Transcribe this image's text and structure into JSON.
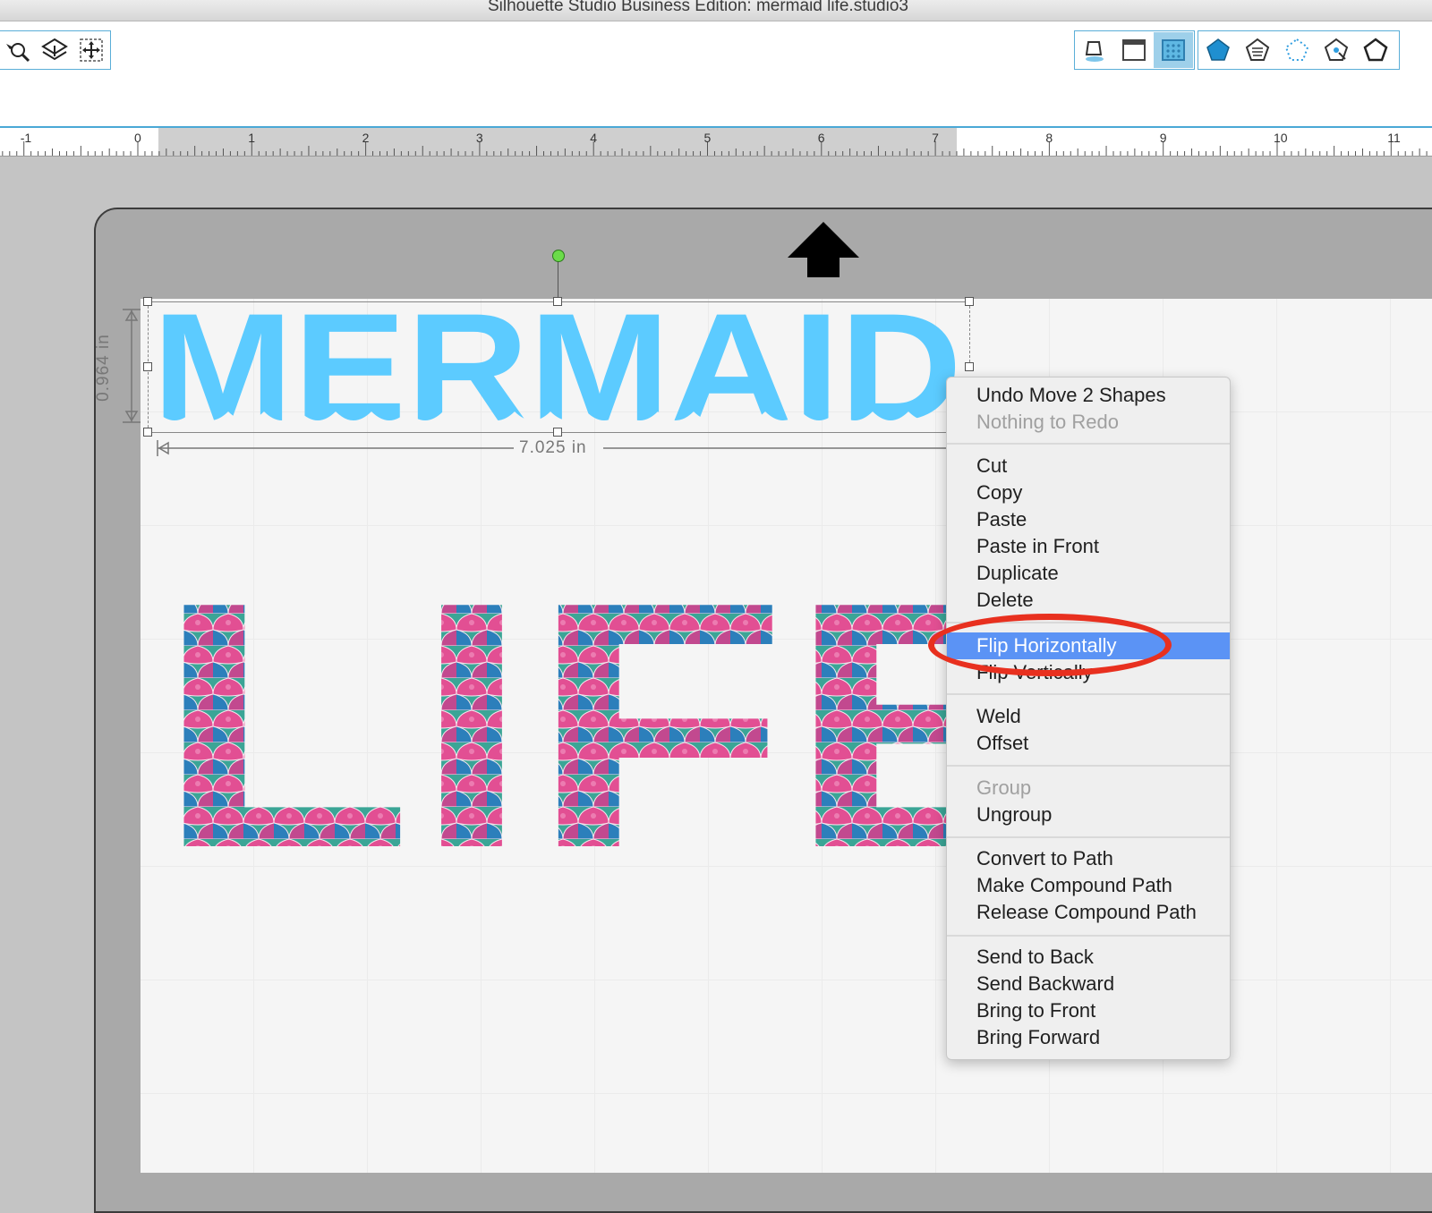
{
  "window": {
    "title": "Silhouette Studio Business Edition: mermaid life.studio3"
  },
  "toolbar": {
    "left_tools": [
      "zoom-select-icon",
      "push-to-back-icon",
      "move-tool-icon"
    ],
    "right_tools": [
      "fill-bucket-icon",
      "solid-fill-icon",
      "pattern-fill-icon",
      "pentagon-fill-icon",
      "layers-pentagon-icon",
      "dotted-pentagon-icon",
      "point-edit-pentagon-icon",
      "outline-pentagon-icon"
    ]
  },
  "ruler": {
    "ticks": [
      "-1",
      "0",
      "1",
      "2",
      "3",
      "4",
      "5",
      "6",
      "7",
      "8",
      "9",
      "10",
      "11"
    ]
  },
  "canvas": {
    "mermaid_text": "MERMAID",
    "life_text": "LIFE",
    "height_label": "0.964 in",
    "width_label": "7.025 in"
  },
  "context_menu": {
    "undo": "Undo Move 2 Shapes",
    "redo": "Nothing to Redo",
    "cut": "Cut",
    "copy": "Copy",
    "paste": "Paste",
    "paste_in_front": "Paste in Front",
    "duplicate": "Duplicate",
    "delete": "Delete",
    "flip_horizontally": "Flip Horizontally",
    "flip_vertically": "Flip Vertically",
    "weld": "Weld",
    "offset": "Offset",
    "group": "Group",
    "ungroup": "Ungroup",
    "convert_to_path": "Convert to Path",
    "make_compound_path": "Make Compound Path",
    "release_compound_path": "Release Compound Path",
    "send_to_back": "Send to Back",
    "send_backward": "Send Backward",
    "bring_to_front": "Bring to Front",
    "bring_forward": "Bring Forward"
  },
  "colors": {
    "mermaid_blue": "#5ccbff",
    "menu_highlight": "#5b93f5",
    "annotation_red": "#e8301f"
  }
}
